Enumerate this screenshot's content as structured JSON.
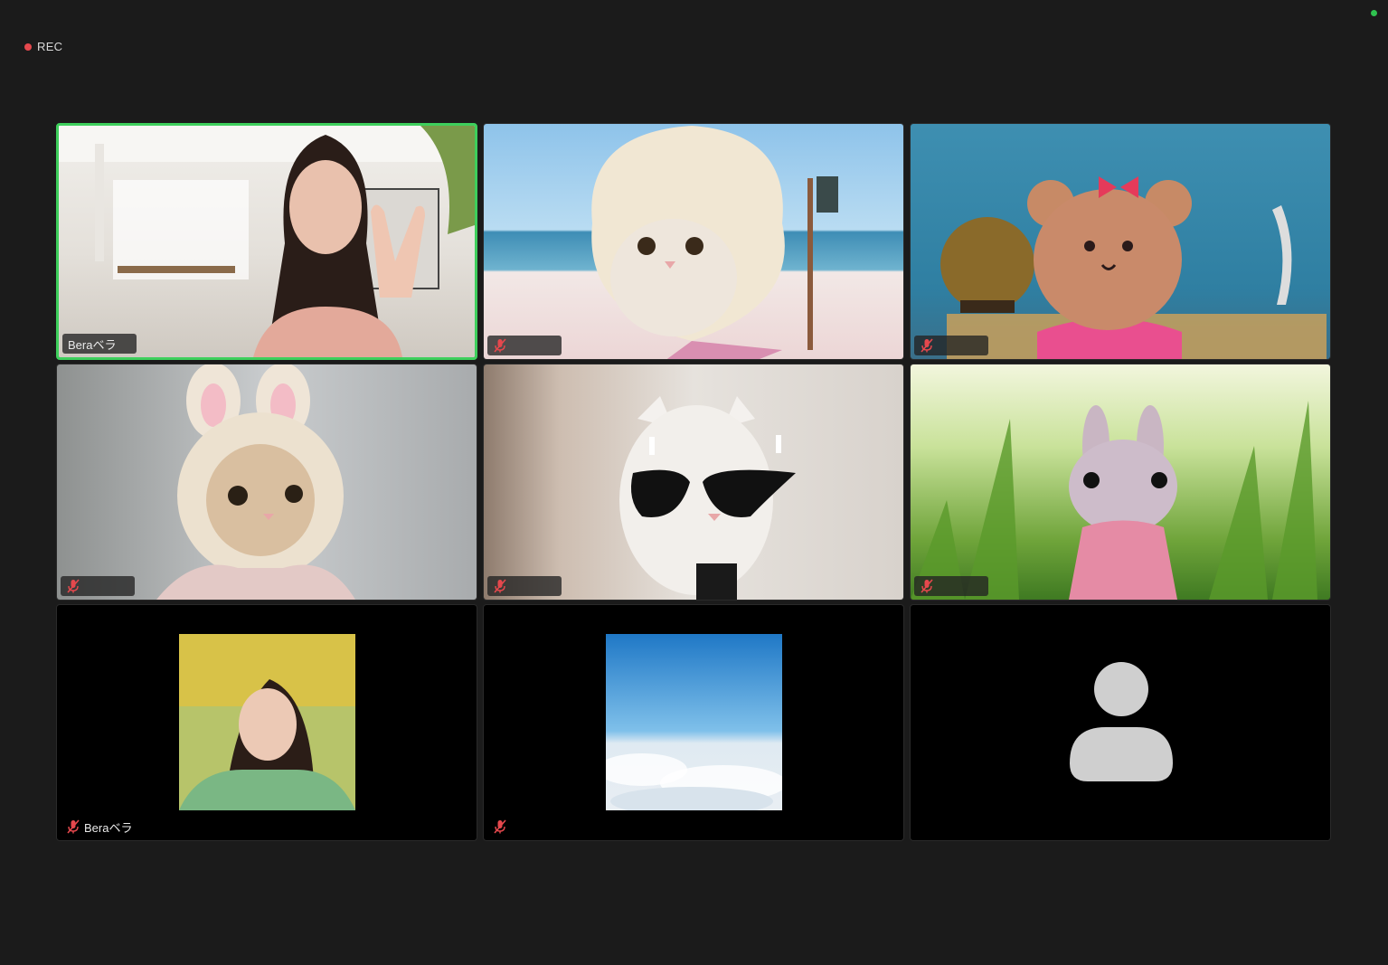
{
  "recording": {
    "label": "REC",
    "dot_color": "#e5484d"
  },
  "camera_indicator_color": "#2fc24f",
  "active_speaker_color": "#3ecf5c",
  "participants": [
    {
      "name": "Beraベラ",
      "muted": false,
      "active": true,
      "video": "on"
    },
    {
      "name": "",
      "muted": true,
      "active": false,
      "video": "on"
    },
    {
      "name": "",
      "muted": true,
      "active": false,
      "video": "on"
    },
    {
      "name": "",
      "muted": true,
      "active": false,
      "video": "on"
    },
    {
      "name": "",
      "muted": true,
      "active": false,
      "video": "on"
    },
    {
      "name": "",
      "muted": true,
      "active": false,
      "video": "on"
    },
    {
      "name": "Beraベラ",
      "muted": true,
      "active": false,
      "video": "off-profile-photo"
    },
    {
      "name": "",
      "muted": true,
      "active": false,
      "video": "off-profile-photo"
    },
    {
      "name": "",
      "muted": false,
      "active": false,
      "video": "off-no-photo"
    }
  ],
  "icons": {
    "muted": "muted-mic-icon",
    "no_photo": "person-avatar-icon"
  }
}
